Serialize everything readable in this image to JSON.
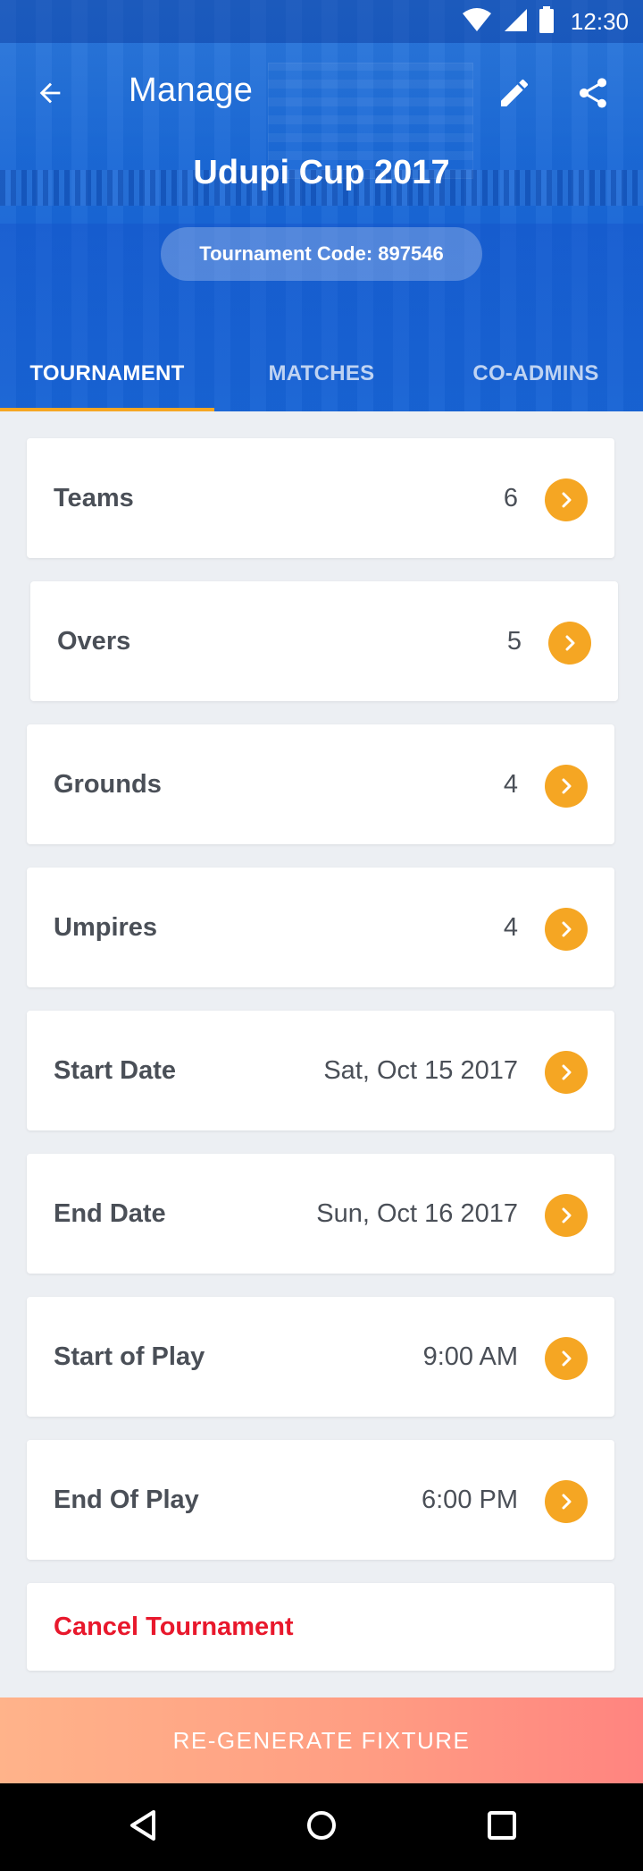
{
  "status_bar": {
    "time": "12:30",
    "icons": [
      "wifi-icon",
      "signal-icon",
      "battery-icon"
    ]
  },
  "toolbar": {
    "title": "Manage",
    "icons": [
      "back-arrow-icon",
      "edit-pencil-icon",
      "share-icon"
    ]
  },
  "tournament": {
    "name": "Udupi Cup 2017",
    "code_label": "Tournament Code: 897546"
  },
  "tabs": [
    {
      "label": "TOURNAMENT",
      "active": true
    },
    {
      "label": "MATCHES",
      "active": false
    },
    {
      "label": "CO-ADMINS",
      "active": false
    }
  ],
  "settings": [
    {
      "label": "Teams",
      "value": "6"
    },
    {
      "label": "Overs",
      "value": "5"
    },
    {
      "label": "Grounds",
      "value": "4"
    },
    {
      "label": "Umpires",
      "value": "4"
    },
    {
      "label": "Start Date",
      "value": "Sat, Oct 15 2017"
    },
    {
      "label": "End Date",
      "value": "Sun, Oct 16 2017"
    },
    {
      "label": "Start of Play",
      "value": "9:00 AM"
    },
    {
      "label": "End Of Play",
      "value": "6:00 PM"
    }
  ],
  "cancel": {
    "label": "Cancel Tournament"
  },
  "regenerate": {
    "label": "RE-GENERATE FIXTURE"
  },
  "colors": {
    "primary": "#1866d6",
    "accent": "#f5a623",
    "danger": "#e8182c",
    "text": "#4a4f57",
    "background": "#eceff3"
  },
  "nav_bar": {
    "icons": [
      "back-triangle-icon",
      "home-circle-icon",
      "recents-square-icon"
    ]
  }
}
